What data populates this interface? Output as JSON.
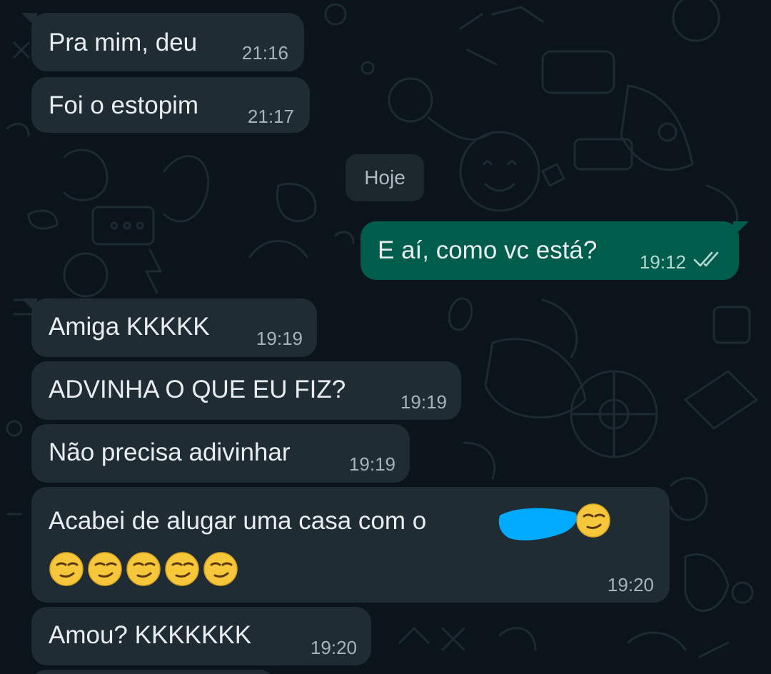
{
  "date_separator": "Hoje",
  "messages": [
    {
      "direction": "incoming",
      "text": "Pra mim, deu",
      "time": "21:16"
    },
    {
      "direction": "incoming",
      "text": "Foi o estopim",
      "time": "21:17"
    },
    {
      "direction": "outgoing",
      "text": "E aí, como vc está?",
      "time": "19:12",
      "status_icon": "double-check-icon"
    },
    {
      "direction": "incoming",
      "text": "Amiga KKKKK",
      "time": "19:19"
    },
    {
      "direction": "incoming",
      "text": "ADVINHA O QUE EU FIZ?",
      "time": "19:19"
    },
    {
      "direction": "incoming",
      "text": "Não precisa adivinhar",
      "time": "19:19"
    },
    {
      "direction": "incoming",
      "text": "Acabei de alugar uma casa com o",
      "emoji_after": "😏",
      "line2": "😏😏😏😏😏",
      "time": "19:20",
      "redacted": true
    },
    {
      "direction": "incoming",
      "text": "Amou? KKKKKKK",
      "time": "19:20"
    }
  ],
  "colors": {
    "background": "#0b141a",
    "incoming_bubble": "#202c33",
    "outgoing_bubble": "#005c4b",
    "redaction": "#00aaff",
    "emoji": "#f6c63b"
  }
}
